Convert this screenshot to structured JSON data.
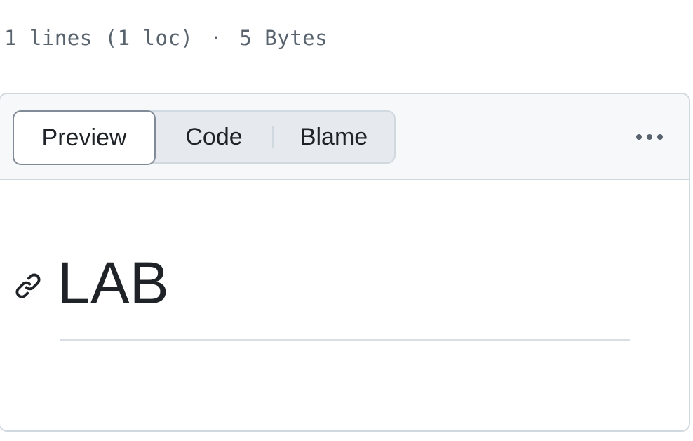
{
  "file_info": {
    "lines": "1 lines (1 loc)",
    "separator": "·",
    "size": "5 Bytes"
  },
  "view_toggle": {
    "preview_label": "Preview",
    "code_label": "Code",
    "blame_label": "Blame",
    "selected": "Preview"
  },
  "more_menu": {
    "icon": "kebab-horizontal-icon"
  },
  "content": {
    "anchor_icon": "link-icon",
    "heading": "LAB"
  },
  "colors": {
    "text": "#1f2328",
    "muted": "#59636e",
    "border": "#d1d9e0",
    "header_bg": "#f6f8fa",
    "segment_bg": "#e6eaef"
  }
}
